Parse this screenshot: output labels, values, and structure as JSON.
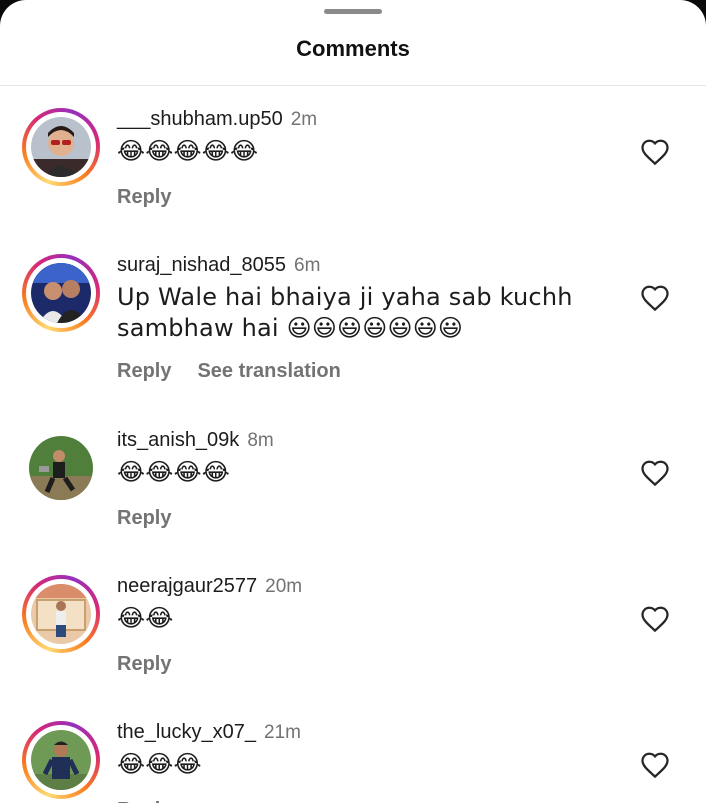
{
  "header": {
    "title": "Comments"
  },
  "actions": {
    "reply": "Reply",
    "see_translation": "See translation"
  },
  "comments": [
    {
      "username": "___shubham.up50",
      "time": "2m",
      "text": "😂😂😂😂😂",
      "has_story_ring": true
    },
    {
      "username": "suraj_nishad_8055",
      "time": "6m",
      "text": "Up Wale hai bhaiya ji yaha sab kuchh sambhaw hai 😃😃😃😃😃😃😃",
      "has_story_ring": true,
      "show_translation": true
    },
    {
      "username": "its_anish_09k",
      "time": "8m",
      "text": "😂😂😂😂",
      "has_story_ring": false
    },
    {
      "username": "neerajgaur2577",
      "time": "20m",
      "text": "😂😂",
      "has_story_ring": true
    },
    {
      "username": "the_lucky_x07_",
      "time": "21m",
      "text": "😂😂😂",
      "has_story_ring": true
    }
  ],
  "icons": {
    "like": "heart-outline-icon",
    "handle": "drag-handle"
  },
  "colors": {
    "username": "#1c1c1c",
    "secondary": "#737373",
    "story_ring": [
      "#feda75",
      "#fa7e1e",
      "#d62976",
      "#962fbf"
    ]
  }
}
